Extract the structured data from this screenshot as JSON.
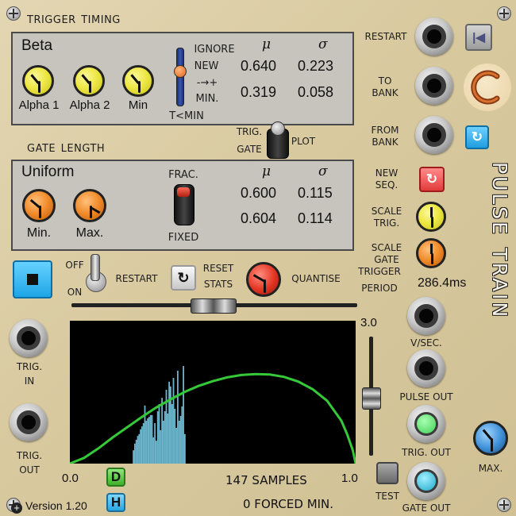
{
  "module": {
    "title": "Pulse Train",
    "version": "Version 1.20"
  },
  "trigger_timing": {
    "header": "Trigger Timing",
    "distribution": "Beta",
    "knob_labels": [
      "Alpha 1",
      "Alpha 2",
      "Min"
    ],
    "mode_labels": [
      "IGNORE",
      "NEW",
      "-→+",
      "MIN."
    ],
    "mode_footer": "T<MIN",
    "mu_symbol": "μ",
    "sigma_symbol": "σ",
    "mu_values": [
      "0.640",
      "0.319"
    ],
    "sigma_values": [
      "0.223",
      "0.058"
    ]
  },
  "plot_switch": {
    "label_left_top": "TRIG.",
    "label_left_bottom": "GATE",
    "label_right": "PLOT"
  },
  "gate_length": {
    "header": "Gate Length",
    "distribution": "Uniform",
    "knob_labels": [
      "Min.",
      "Max."
    ],
    "frac_label": "FRAC.",
    "fixed_label": "FIXED",
    "mu_symbol": "μ",
    "sigma_symbol": "σ",
    "mu_values": [
      "0.600",
      "0.604"
    ],
    "sigma_values": [
      "0.115",
      "0.114"
    ]
  },
  "controls": {
    "off_label": "OFF",
    "on_label": "ON",
    "restart_label": "RESTART",
    "reset_stats_label": [
      "RESET",
      "STATS"
    ],
    "quantise_label": "QUANTISE",
    "trigger_period_label": [
      "TRIGGER",
      "PERIOD"
    ],
    "trigger_period_value": "286.4ms"
  },
  "right_column": {
    "restart": "RESTART",
    "to_bank": [
      "TO",
      "BANK"
    ],
    "from_bank": [
      "FROM",
      "BANK"
    ],
    "new_seq": [
      "NEW",
      "SEQ."
    ],
    "scale_trig": [
      "SCALE",
      "TRIG."
    ],
    "scale_gate": [
      "SCALE",
      "GATE"
    ],
    "v_sec": "V/SEC.",
    "pulse_out": "PULSE OUT",
    "trig_out": "TRIG. OUT",
    "gate_out": "GATE OUT",
    "max": "MAX.",
    "test": "TEST"
  },
  "left_column": {
    "trig_in": [
      "TRIG.",
      "IN"
    ],
    "trig_out": [
      "TRIG.",
      "OUT"
    ]
  },
  "plot": {
    "x_min_label": "0.0",
    "x_max_label": "1.0",
    "y_max_label": "3.0",
    "samples_text": "147 SAMPLES",
    "forced_min_text": "0 FORCED MIN.",
    "d_button": "D",
    "h_button": "H"
  },
  "chart_data": {
    "type": "area",
    "x_range": [
      0.0,
      1.0
    ],
    "y_range": [
      0.0,
      3.0
    ],
    "curve_color": "#35c93a",
    "histogram_color": "#6ab4cc",
    "curve": {
      "x": [
        0.0,
        0.05,
        0.1,
        0.15,
        0.2,
        0.25,
        0.3,
        0.35,
        0.4,
        0.45,
        0.5,
        0.55,
        0.6,
        0.65,
        0.7,
        0.75,
        0.8,
        0.85,
        0.9,
        0.95,
        0.97,
        0.99,
        1.0
      ],
      "y": [
        0.0,
        0.12,
        0.32,
        0.55,
        0.76,
        0.97,
        1.17,
        1.34,
        1.5,
        1.63,
        1.73,
        1.81,
        1.86,
        1.88,
        1.87,
        1.82,
        1.72,
        1.56,
        1.32,
        0.9,
        0.62,
        0.28,
        0.0
      ]
    },
    "histogram": {
      "x": [
        0.22,
        0.225,
        0.23,
        0.235,
        0.24,
        0.245,
        0.25,
        0.255,
        0.26,
        0.265,
        0.27,
        0.275,
        0.28,
        0.285,
        0.29,
        0.295,
        0.3,
        0.305,
        0.31,
        0.315,
        0.32,
        0.325,
        0.33,
        0.335,
        0.34,
        0.345,
        0.35,
        0.355,
        0.36,
        0.365,
        0.37,
        0.375,
        0.38,
        0.385,
        0.39,
        0.395,
        0.4
      ],
      "y": [
        0.28,
        0.42,
        0.5,
        0.58,
        0.62,
        0.72,
        0.78,
        0.85,
        1.22,
        0.9,
        0.95,
        0.98,
        1.02,
        1.02,
        0.55,
        0.85,
        0.48,
        1.1,
        1.25,
        0.7,
        1.38,
        0.9,
        1.1,
        1.55,
        1.05,
        1.72,
        1.62,
        1.25,
        1.8,
        1.15,
        0.75,
        1.95,
        0.9,
        1.0,
        1.2,
        2.05,
        0.62
      ]
    }
  }
}
